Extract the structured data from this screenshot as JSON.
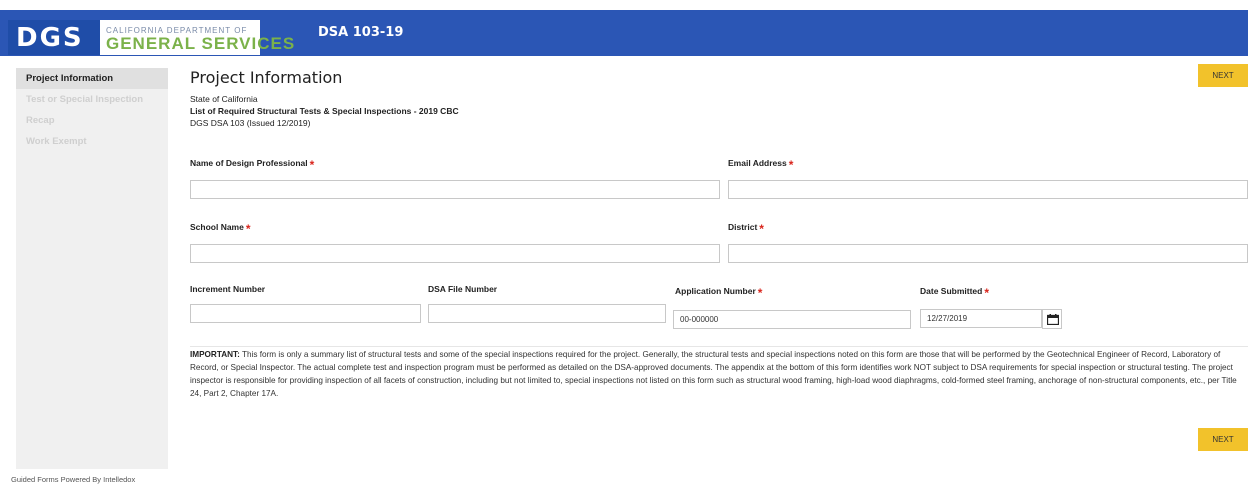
{
  "header": {
    "logo_text": "DGS",
    "logo_subtitle": "CALIFORNIA DEPARTMENT OF",
    "logo_title": "GENERAL SERVICES",
    "form_title": "DSA 103-19"
  },
  "sidebar": {
    "items": [
      {
        "label": "Project Information",
        "active": true
      },
      {
        "label": "Test or Special Inspection",
        "active": false
      },
      {
        "label": "Recap",
        "active": false
      },
      {
        "label": "Work Exempt",
        "active": false
      }
    ]
  },
  "page": {
    "title": "Project Information",
    "meta_line1": "State of California",
    "meta_line2": "List of Required Structural Tests & Special Inspections  -  2019 CBC",
    "meta_line3": "DGS DSA 103 (Issued 12/2019)",
    "next_label": "NEXT"
  },
  "form": {
    "design_professional": {
      "label": "Name of Design Professional",
      "value": "",
      "required": true
    },
    "email": {
      "label": "Email Address",
      "value": "",
      "required": true
    },
    "school_name": {
      "label": "School Name",
      "value": "",
      "required": true
    },
    "district": {
      "label": "District",
      "value": "",
      "required": true
    },
    "increment_number": {
      "label": "Increment Number",
      "value": "",
      "required": false
    },
    "dsa_file_number": {
      "label": "DSA File Number",
      "value": "",
      "required": false
    },
    "application_number": {
      "label": "Application Number",
      "value": "00-000000",
      "required": true
    },
    "date_submitted": {
      "label": "Date Submitted",
      "value": "12/27/2019",
      "required": true
    },
    "required_marker": "*"
  },
  "notice": {
    "lead": "IMPORTANT:",
    "body": " This form is only a summary list of structural tests and some of the special inspections required for the project. Generally, the structural tests and special inspections noted on this form are those that will be performed by the Geotechnical Engineer of Record, Laboratory of Record, or Special Inspector. The actual complete test and inspection program must be performed as detailed on the DSA-approved documents. The appendix at the bottom of this form identifies work NOT subject to DSA requirements for special inspection or structural testing. The project inspector is responsible for providing inspection of all facets of construction, including but not limited to, special inspections not listed on this form such as structural wood framing, high-load wood diaphragms, cold-formed steel framing, anchorage of non-structural components, etc., per Title 24, Part 2, Chapter 17A."
  },
  "footer": {
    "text": "Guided Forms Powered By Intelledox"
  },
  "colors": {
    "header_bg": "#2b56b5",
    "button_bg": "#f2c22b",
    "required": "#d9251c",
    "logo_green": "#7bb24a"
  }
}
